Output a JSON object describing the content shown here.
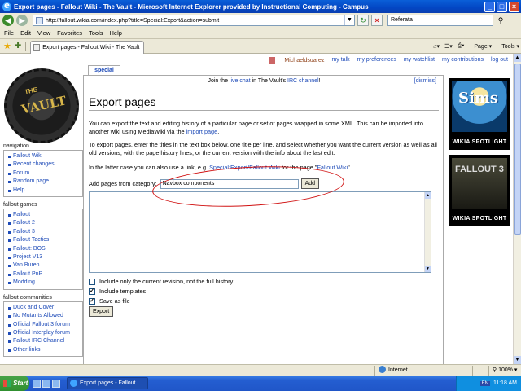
{
  "window": {
    "title": "Export pages - Fallout Wiki - The Vault - Microsoft Internet Explorer provided by Instructional Computing - Campus",
    "url": "http://fallout.wikia.com/index.php?title=Special:Export&action=submit",
    "search_value": "Referata"
  },
  "menu": [
    "File",
    "Edit",
    "View",
    "Favorites",
    "Tools",
    "Help"
  ],
  "tab_title": "Export pages - Fallout Wiki - The Vault",
  "commands": [
    "Page",
    "Tools"
  ],
  "userbar": {
    "username": "Michaeldsuarez",
    "links": [
      "my talk",
      "my preferences",
      "my watchlist",
      "my contributions",
      "log out"
    ]
  },
  "logo": {
    "the": "THE",
    "vault": "VAULT"
  },
  "sidebar": [
    {
      "heading": "navigation",
      "items": [
        "Fallout Wiki",
        "Recent changes",
        "Forum",
        "Random page",
        "Help"
      ]
    },
    {
      "heading": "fallout games",
      "items": [
        "Fallout",
        "Fallout 2",
        "Fallout 3",
        "Fallout Tactics",
        "Fallout: BOS",
        "Project V13",
        "Van Buren",
        "Fallout PnP",
        "Modding"
      ]
    },
    {
      "heading": "fallout communities",
      "items": [
        "Duck and Cover",
        "No Mutants Allowed",
        "Official Fallout 3 forum",
        "Official Interplay forum",
        "Fallout IRC Channel",
        "Other links"
      ]
    }
  ],
  "page": {
    "tab_label": "special",
    "notice_pre": "Join the ",
    "notice_link1": "live chat",
    "notice_mid": " in The Vault's ",
    "notice_link2": "IRC channel",
    "notice_post": "!",
    "dismiss": "[dismiss]",
    "title": "Export pages",
    "p1_a": "You can export the text and editing history of a particular page or set of pages wrapped in some XML. This can be imported into another wiki using MediaWiki via the ",
    "p1_link": "import page",
    "p1_b": ".",
    "p2": "To export pages, enter the titles in the text box below, one title per line, and select whether you want the current version as well as all old versions, with the page history lines, or the current version with the info about the last edit.",
    "p3_a": "In the latter case you can also use a link, e.g. ",
    "p3_link1": "Special:Export/Fallout Wiki",
    "p3_b": " for the page \"",
    "p3_link2": "Fallout Wiki",
    "p3_c": "\".",
    "category_label": "Add pages from category:",
    "category_value": "Navbox components",
    "add_button": "Add",
    "checkboxes": [
      {
        "label": "Include only the current revision, not the full history",
        "checked": false
      },
      {
        "label": "Include templates",
        "checked": true
      },
      {
        "label": "Save as file",
        "checked": true
      }
    ],
    "export_button": "Export"
  },
  "spotlights": [
    {
      "art_text": "Sims",
      "caption": "WIKIA SPOTLIGHT"
    },
    {
      "art_text": "FALLOUT 3",
      "caption": "WIKIA SPOTLIGHT"
    }
  ],
  "status": {
    "zone": "Internet",
    "zoom": "100%"
  },
  "taskbar": {
    "start": "Start",
    "task": "Export pages - Fallout...",
    "lang": "EN",
    "time": "11:18 AM"
  }
}
